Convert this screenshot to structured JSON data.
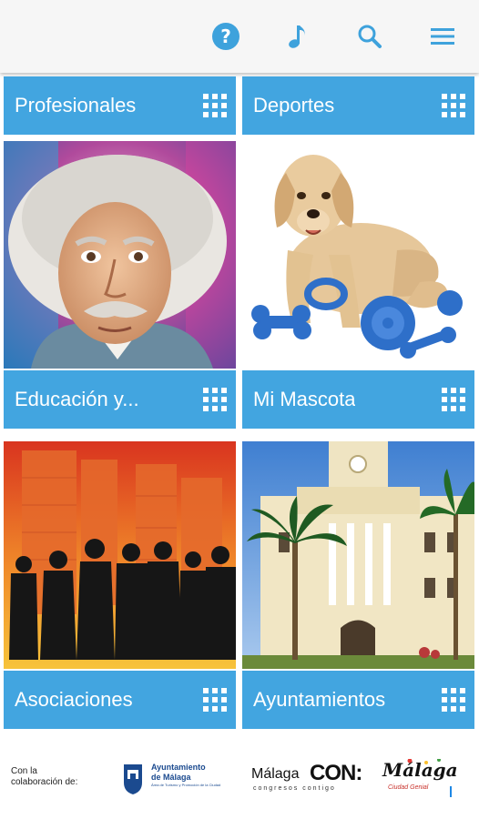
{
  "toolbar": {
    "help_icon": "help-circle-icon",
    "music_icon": "music-note-icon",
    "search_icon": "search-icon",
    "menu_icon": "menu-icon"
  },
  "colors": {
    "accent": "#42a5e0",
    "appbar": "#f6f6f6"
  },
  "tiles": [
    {
      "label": "Profesionales"
    },
    {
      "label": "Deportes"
    },
    {
      "label": "Educación y..."
    },
    {
      "label": "Mi Mascota"
    },
    {
      "label": "Asociaciones"
    },
    {
      "label": "Ayuntamientos"
    }
  ],
  "footer": {
    "collab_line1": "Con la",
    "collab_line2": "colaboración de:",
    "ayto_line1": "Ayuntamiento",
    "ayto_line2": "de Málaga",
    "ayto_line3": "Área de Turismo y Promoción de la Ciudad",
    "congresos_a": "Málaga",
    "congresos_b": "CON:",
    "congresos_sub": "congresos contigo",
    "malaga_logo": "Málaga",
    "malaga_sub": "Ciudad Genial"
  }
}
